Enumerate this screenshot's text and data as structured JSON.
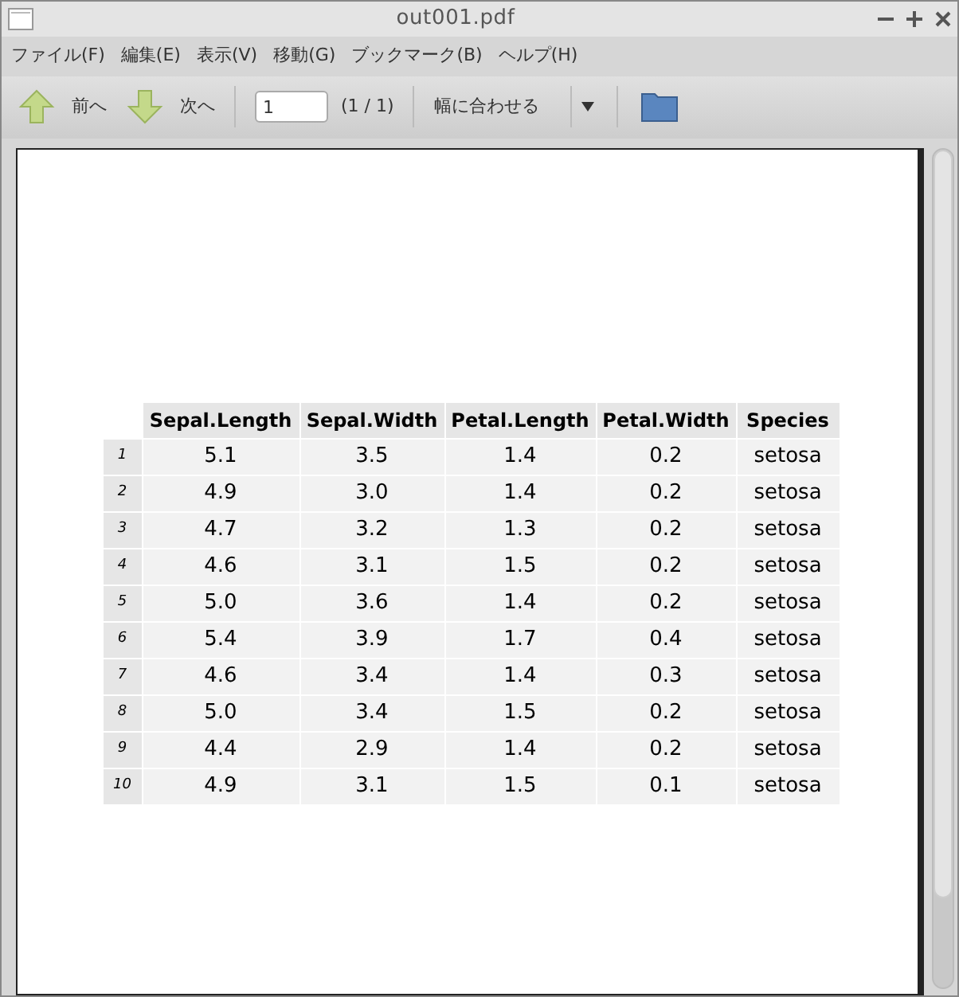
{
  "window": {
    "title": "out001.pdf"
  },
  "menu": [
    "ファイル(F)",
    "編集(E)",
    "表示(V)",
    "移動(G)",
    "ブックマーク(B)",
    "ヘルプ(H)"
  ],
  "toolbar": {
    "prev": "前へ",
    "next": "次へ",
    "page": "1",
    "page_count": "(1 / 1)",
    "zoom": "幅に合わせる"
  },
  "table": {
    "columns": [
      "Sepal.Length",
      "Sepal.Width",
      "Petal.Length",
      "Petal.Width",
      "Species"
    ],
    "rows": [
      {
        "index": "1",
        "cells": [
          "5.1",
          "3.5",
          "1.4",
          "0.2",
          "setosa"
        ]
      },
      {
        "index": "2",
        "cells": [
          "4.9",
          "3.0",
          "1.4",
          "0.2",
          "setosa"
        ]
      },
      {
        "index": "3",
        "cells": [
          "4.7",
          "3.2",
          "1.3",
          "0.2",
          "setosa"
        ]
      },
      {
        "index": "4",
        "cells": [
          "4.6",
          "3.1",
          "1.5",
          "0.2",
          "setosa"
        ]
      },
      {
        "index": "5",
        "cells": [
          "5.0",
          "3.6",
          "1.4",
          "0.2",
          "setosa"
        ]
      },
      {
        "index": "6",
        "cells": [
          "5.4",
          "3.9",
          "1.7",
          "0.4",
          "setosa"
        ]
      },
      {
        "index": "7",
        "cells": [
          "4.6",
          "3.4",
          "1.4",
          "0.3",
          "setosa"
        ]
      },
      {
        "index": "8",
        "cells": [
          "5.0",
          "3.4",
          "1.5",
          "0.2",
          "setosa"
        ]
      },
      {
        "index": "9",
        "cells": [
          "4.4",
          "2.9",
          "1.4",
          "0.2",
          "setosa"
        ]
      },
      {
        "index": "10",
        "cells": [
          "4.9",
          "3.1",
          "1.5",
          "0.1",
          "setosa"
        ]
      }
    ]
  }
}
